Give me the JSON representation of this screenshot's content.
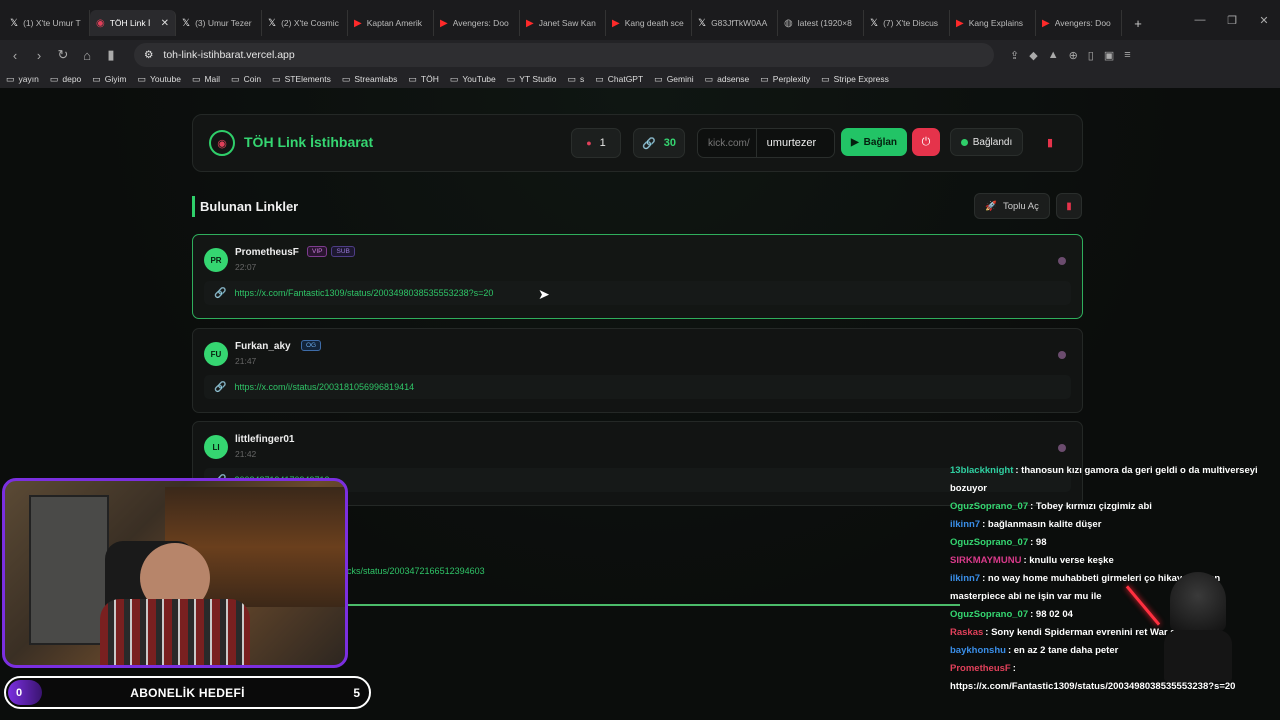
{
  "tabs": [
    {
      "icon": "x-icon",
      "title": "(1) X'te Umur T",
      "active": false
    },
    {
      "icon": "toh-icon",
      "title": "TÖH Link İ",
      "active": true
    },
    {
      "icon": "x-icon",
      "title": "(3) Umur Tezer",
      "active": false
    },
    {
      "icon": "x-icon",
      "title": "(2) X'te Cosmic",
      "active": false
    },
    {
      "icon": "youtube-icon",
      "title": "Kaptan Amerik",
      "active": false
    },
    {
      "icon": "youtube-icon",
      "title": "Avengers: Doo",
      "active": false
    },
    {
      "icon": "youtube-icon",
      "title": "Janet Saw Kan",
      "active": false
    },
    {
      "icon": "youtube-icon",
      "title": "Kang death sce",
      "active": false
    },
    {
      "icon": "x-icon",
      "title": "G83JfTkW0AA",
      "active": false
    },
    {
      "icon": "globe-icon",
      "title": "latest (1920×8",
      "active": false
    },
    {
      "icon": "x-icon",
      "title": "(7) X'te Discus",
      "active": false
    },
    {
      "icon": "youtube-icon",
      "title": "Kang Explains",
      "active": false
    },
    {
      "icon": "youtube-icon",
      "title": "Avengers: Doo",
      "active": false
    }
  ],
  "url": "toh-link-istihbarat.vercel.app",
  "bookmarks": [
    "yayın",
    "depo",
    "Giyim",
    "Youtube",
    "Mail",
    "Coin",
    "STElements",
    "Streamlabs",
    "TÖH",
    "YouTube",
    "YT Studio",
    "s",
    "ChatGPT",
    "Gemini",
    "adsense",
    "Perplexity",
    "Stripe Express"
  ],
  "header": {
    "title": "TÖH Link İstihbarat",
    "alert_count": "1",
    "link_count": "30",
    "kick_prefix": "kick.com/",
    "channel": "umurtezer",
    "connect_label": "Bağlan",
    "status_label": "Bağlandı"
  },
  "section": {
    "title": "Bulunan Linkler",
    "bulk_open": "Toplu Aç"
  },
  "cards": [
    {
      "initials": "PR",
      "user": "PrometheusF",
      "badges": [
        "VIP",
        "SUB"
      ],
      "time": "22:07",
      "link": "https://x.com/Fantastic1309/status/2003498038535553238?s=20"
    },
    {
      "initials": "FU",
      "user": "Furkan_aky",
      "badges": [
        "OG"
      ],
      "time": "21:47",
      "link": "https://x.com/i/status/2003181056996819414"
    },
    {
      "initials": "LI",
      "user": "littlefinger01",
      "badges": [],
      "time": "21:42",
      "link": "2003487194170949713"
    }
  ],
  "overlay": {
    "sub_count": "0",
    "sub_label": "ABONELİK HEDEFİ",
    "sub_goal": "5",
    "partial_link": "icks/status/2003472166512394603"
  },
  "chat": [
    {
      "user": "13blackknight",
      "color": "#2fcfa0",
      "text": ": thanosun kızı gamora da geri geldi o da multiverseyi bozuyor"
    },
    {
      "user": "OguzSoprano_07",
      "color": "#35d671",
      "text": ": Tobey kırmızı çizgimiz abi"
    },
    {
      "user": "ilkinn7",
      "color": "#3a8ee8",
      "text": ": bağlanmasın kalite düşer"
    },
    {
      "user": "OguzSoprano_07",
      "color": "#35d671",
      "text": ": 98"
    },
    {
      "user": "SIRKMAYMUNU",
      "color": "#d83a8a",
      "text": ": knullu verse keşke"
    },
    {
      "user": "ilkinn7",
      "color": "#3a8ee8",
      "text": ": no way home muhabbeti girmeleri ço hikayen zaten masterpiece abi ne işin var mu ile"
    },
    {
      "user": "OguzSoprano_07",
      "color": "#35d671",
      "text": ": 98 02 04"
    },
    {
      "user": "Raskas",
      "color": "#e0405a",
      "text": ": Sony kendi Spiderman evrenini ret War sonrasi"
    },
    {
      "user": "baykhonshu",
      "color": "#3a8ee8",
      "text": ": en az 2 tane daha peter"
    },
    {
      "user": "PrometheusF",
      "color": "#e0405a",
      "text": ":"
    },
    {
      "user": "",
      "color": "#fff",
      "text": "https://x.com/Fantastic1309/status/2003498038535553238?s=20"
    }
  ]
}
